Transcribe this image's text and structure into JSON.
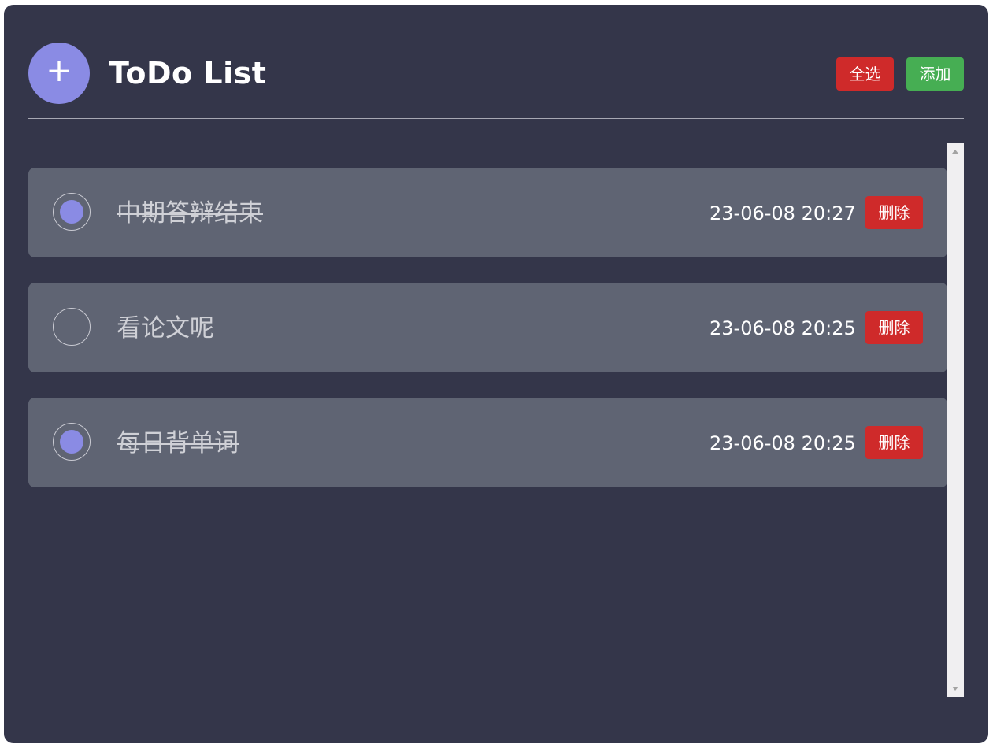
{
  "header": {
    "add_icon": "+",
    "title": "ToDo List",
    "select_all_label": "全选",
    "add_label": "添加"
  },
  "todos": [
    {
      "text": "中期答辩结束",
      "time": "23-06-08 20:27",
      "done": true,
      "delete_label": "删除"
    },
    {
      "text": "看论文呢",
      "time": "23-06-08 20:25",
      "done": false,
      "delete_label": "删除"
    },
    {
      "text": "每日背单词",
      "time": "23-06-08 20:25",
      "done": true,
      "delete_label": "删除"
    }
  ],
  "colors": {
    "background": "#34364a",
    "item_background": "#5f6473",
    "accent": "#8a8be4",
    "danger": "#cf2a2a",
    "success": "#46ae53"
  }
}
